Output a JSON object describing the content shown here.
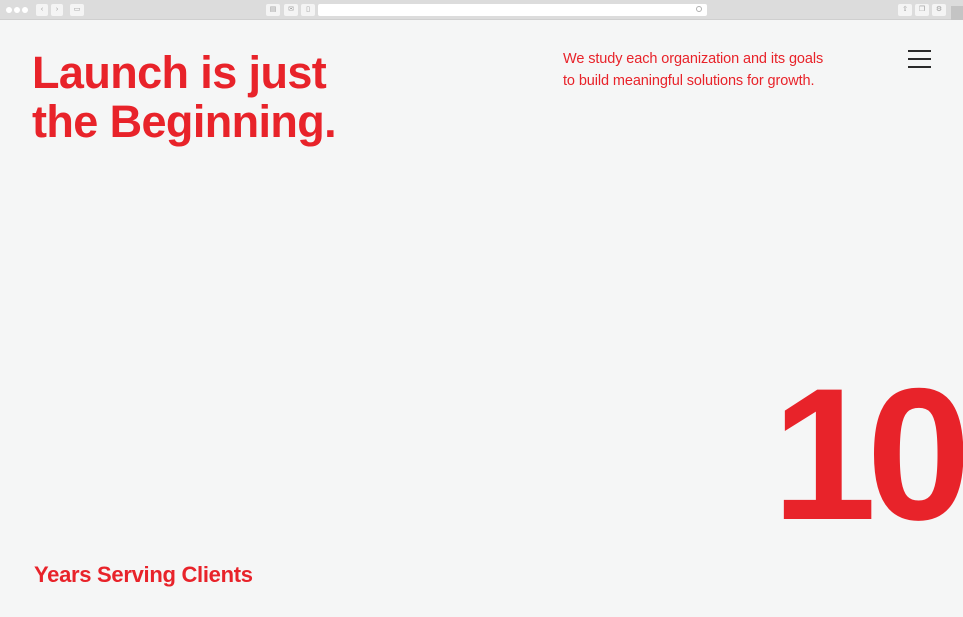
{
  "browser": {
    "toolbar_icons": [
      "close-dot",
      "minimize-dot",
      "zoom-dot",
      "back-icon",
      "forward-icon",
      "sidebar-icon",
      "print-icon",
      "mail-icon",
      "bookmark-icon",
      "reload-icon",
      "share-icon",
      "duplicate-icon",
      "settings-icon"
    ],
    "colors": {
      "chrome": "#dcdcdc",
      "button": "#f4f4f4"
    }
  },
  "hero": {
    "headline_line1": "Launch is just",
    "headline_line2": "the Beginning.",
    "tagline_line1": "We study each organization and its goals",
    "tagline_line2": "to build meaningful solutions for growth."
  },
  "nav": {
    "menu_icon": "hamburger-menu-icon"
  },
  "stats": {
    "years_value": "10",
    "years_label": "Years Serving Clients"
  },
  "colors": {
    "accent": "#e8232a",
    "background": "#f5f6f6",
    "menu_icon": "#2a2a2a"
  }
}
